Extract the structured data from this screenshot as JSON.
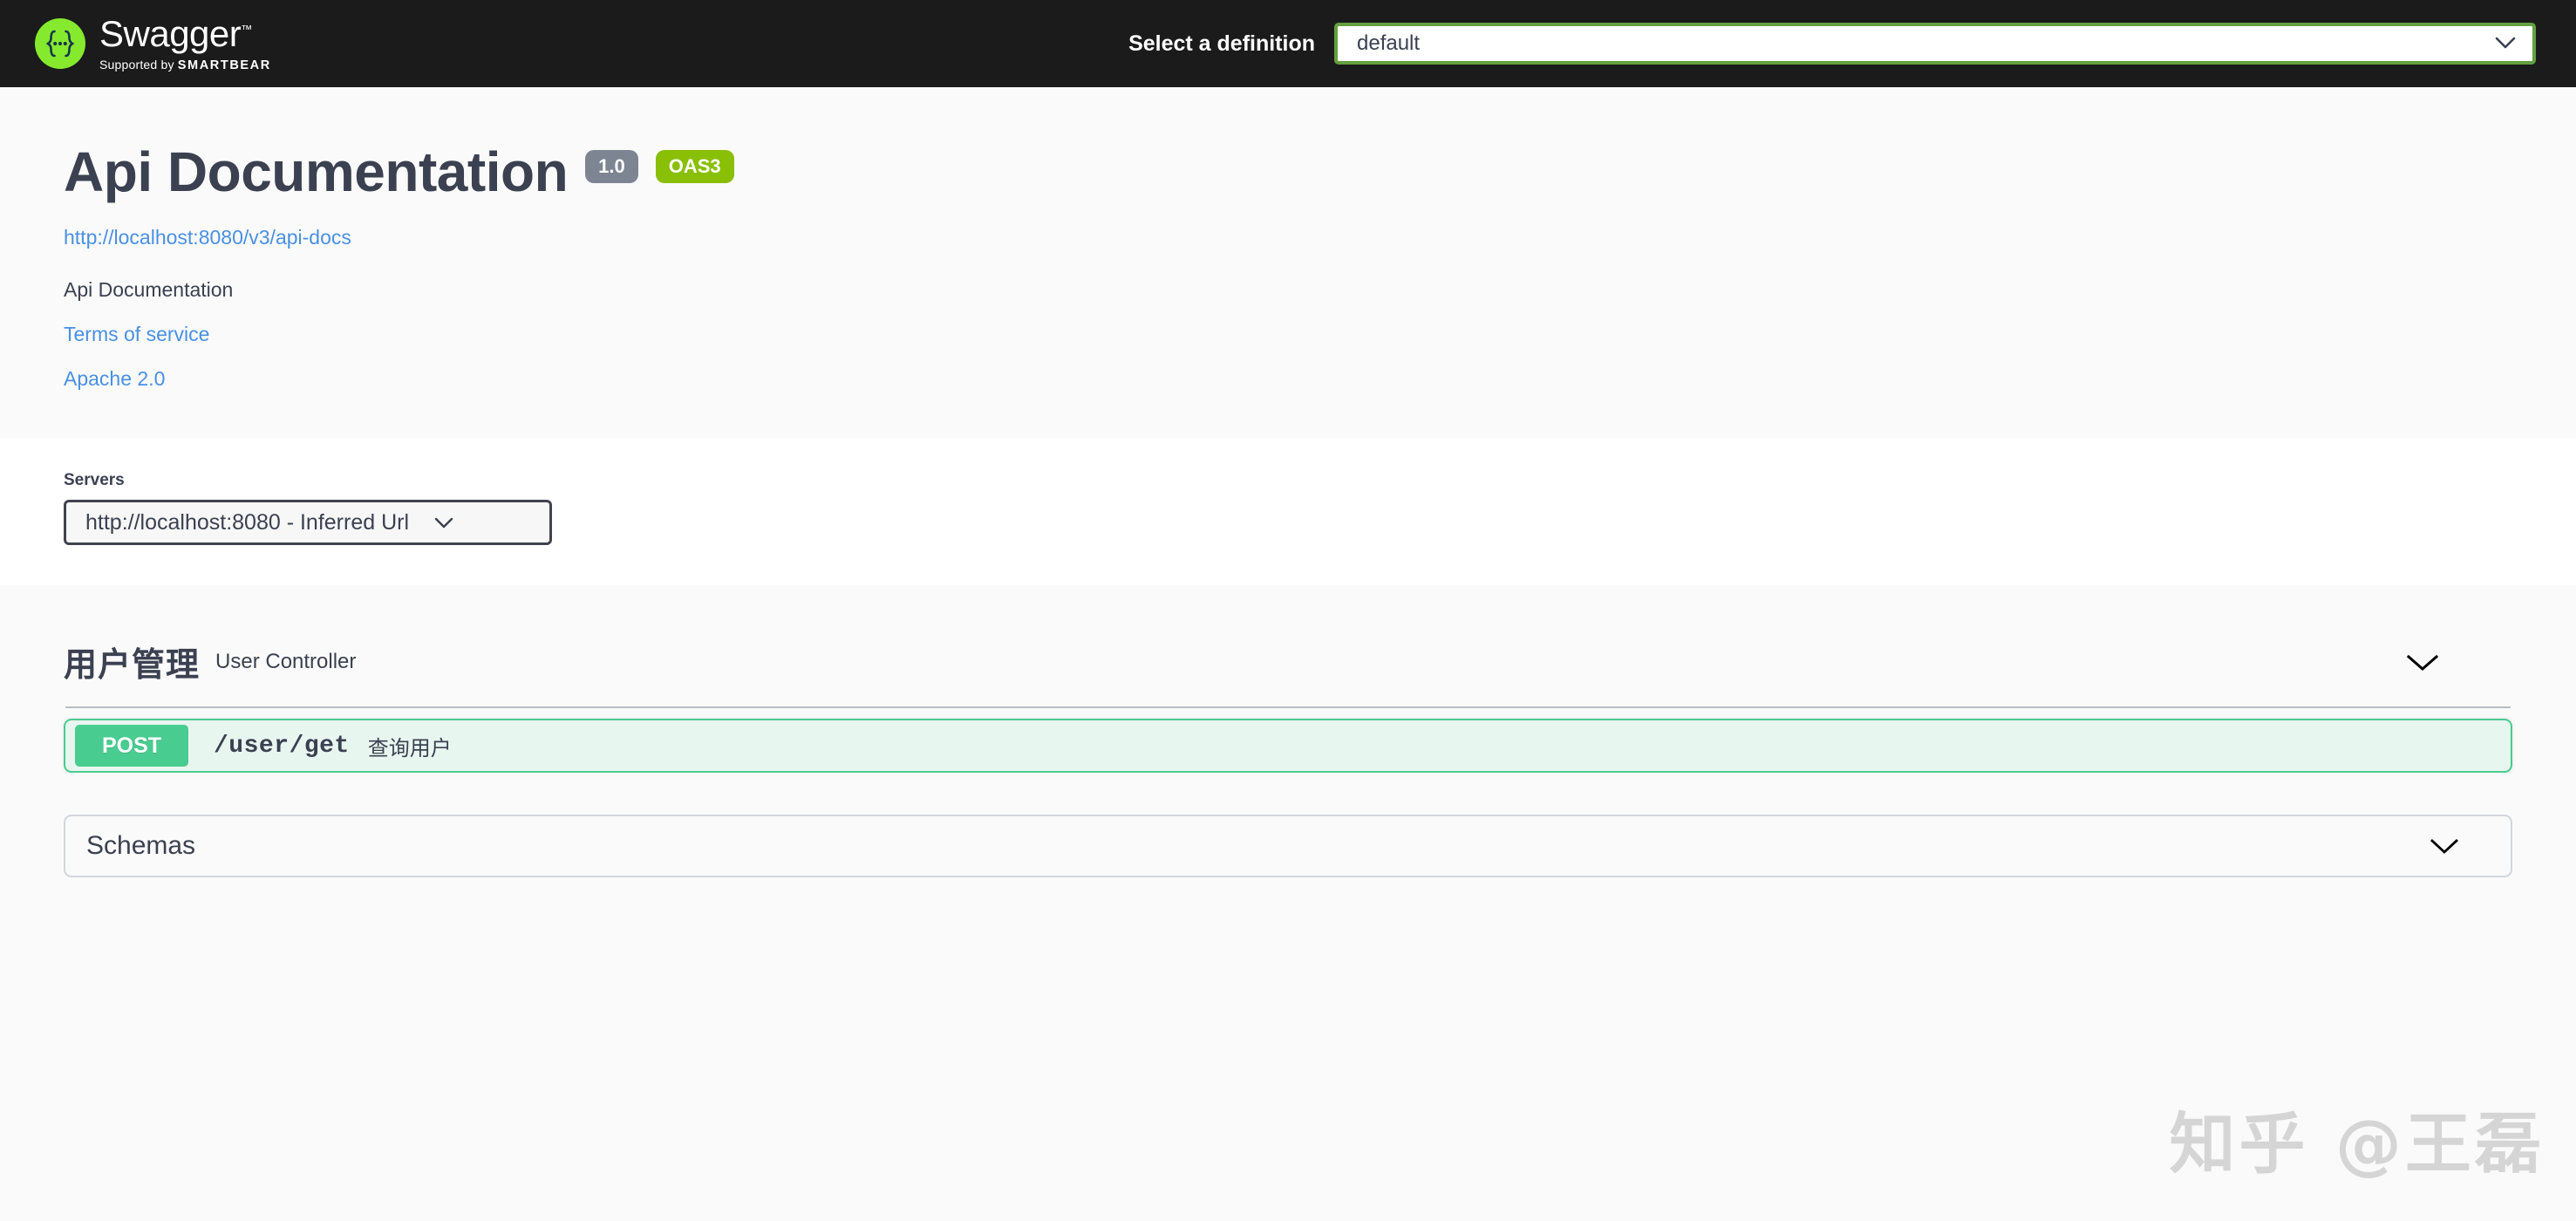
{
  "topbar": {
    "logo_alt": "Swagger",
    "brand_name": "Swagger",
    "brand_tm": "™",
    "supported_by_prefix": "Supported by ",
    "supported_by_name": "SMARTBEAR",
    "definition_label": "Select a definition",
    "definition_value": "default",
    "definition_options": [
      "default"
    ]
  },
  "info": {
    "title": "Api Documentation",
    "version_badge": "1.0",
    "spec_badge": "OAS3",
    "url": "http://localhost:8080/v3/api-docs",
    "description": "Api Documentation",
    "terms_link": "Terms of service",
    "license_link": "Apache 2.0"
  },
  "servers": {
    "label": "Servers",
    "selected": "http://localhost:8080 - Inferred Url",
    "options": [
      "http://localhost:8080 - Inferred Url"
    ]
  },
  "tags": [
    {
      "name": "用户管理",
      "description": "User Controller",
      "operations": [
        {
          "method": "POST",
          "path": "/user/get",
          "summary": "查询用户"
        }
      ]
    }
  ],
  "schemas": {
    "title": "Schemas"
  },
  "watermark": {
    "text": "知乎 @王磊"
  },
  "colors": {
    "topbar_bg": "#1b1b1b",
    "logo_green": "#85ea2d",
    "oas_badge": "#89bf04",
    "version_badge": "#7d8492",
    "post_green": "#49cc90",
    "post_bg": "#e8f6f0",
    "link_blue": "#4990e2",
    "text": "#3b4151",
    "page_bg": "#fafafa"
  }
}
